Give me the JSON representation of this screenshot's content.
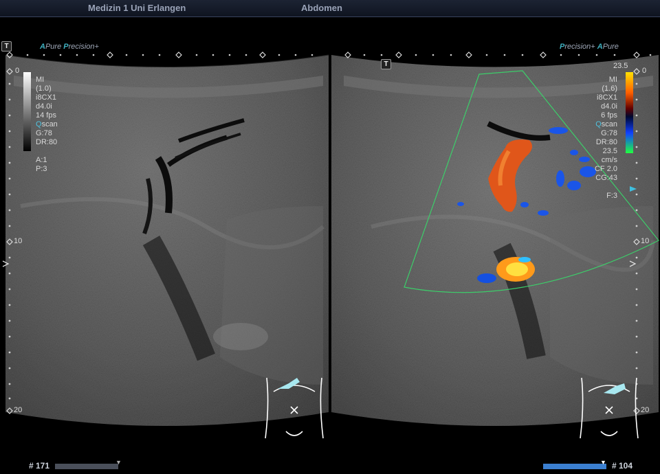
{
  "header": {
    "institution": "Medizin 1 Uni Erlangen",
    "exam": "Abdomen"
  },
  "left_panel": {
    "title_prefix": "A",
    "title_main": "Pure ",
    "title_p": "P",
    "title_rest": "recision+",
    "params": {
      "mi_label": "MI",
      "mi_value": "(1.0)",
      "probe": "i8CX1",
      "depth_freq": "d4.0i",
      "fps": "14 fps",
      "scan_q": "Q",
      "scan_rest": "scan",
      "gain": "G:78",
      "dr": "DR:80",
      "a": "A:1",
      "p": "P:3"
    },
    "depth_labels": [
      "0",
      "10",
      "20"
    ]
  },
  "right_panel": {
    "title_p": "P",
    "title_rest": "recision+",
    "title_prefix": "A",
    "title_main": "Pure",
    "scale_top": "23.5",
    "params": {
      "mi_label": "MI",
      "mi_value": "(1.6)",
      "probe": "i8CX1",
      "depth_freq": "d4.0i",
      "fps": "6 fps",
      "scan_q": "Q",
      "scan_rest": "scan",
      "gain": "G:78",
      "dr": "DR:80",
      "vel": "23.5",
      "vel_unit": "cm/s",
      "cf": "CF 2.0",
      "cg": "CG:43",
      "f": "F:3"
    },
    "depth_labels": [
      "0",
      "10",
      "20"
    ]
  },
  "marker_letter": "T",
  "footer": {
    "left_frame": "# 171",
    "right_frame": "# 104"
  },
  "colors": {
    "header_text": "#9aa3b8",
    "accent": "#3fb0c0",
    "roi_box": "#3ccf6a",
    "footer_bar_right": "#3b7fd0"
  }
}
